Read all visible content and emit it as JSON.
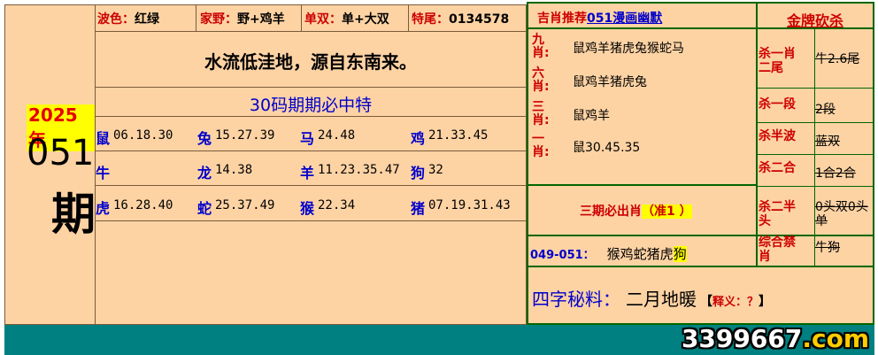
{
  "header": {
    "bose_label": "波色：",
    "bose_value": "红绿",
    "jiaye_label": "家野：",
    "jiaye_value": "野+鸡羊",
    "danshuang_label": "单双：",
    "danshuang_value": "单+大双",
    "tewei_label": "特尾：",
    "tewei_value": "0134578"
  },
  "issue": {
    "year": "2025年",
    "number": "051",
    "suffix": "期"
  },
  "slogan": "水流低洼地，源自东南来。",
  "bingo_title": "30码期期必中特",
  "zodiac_table": [
    [
      {
        "z": "鼠",
        "n": "06.18.30"
      },
      {
        "z": "兔",
        "n": "15.27.39"
      },
      {
        "z": "马",
        "n": "24.48"
      },
      {
        "z": "鸡",
        "n": "21.33.45"
      }
    ],
    [
      {
        "z": "牛",
        "n": ""
      },
      {
        "z": "龙",
        "n": "14.38"
      },
      {
        "z": "羊",
        "n": "11.23.35.47"
      },
      {
        "z": "狗",
        "n": "32"
      }
    ],
    [
      {
        "z": "虎",
        "n": "16.28.40"
      },
      {
        "z": "蛇",
        "n": "25.37.49"
      },
      {
        "z": "猴",
        "n": "22.34"
      },
      {
        "z": "猪",
        "n": "07.19.31.43"
      }
    ]
  ],
  "right": {
    "title_prefix": "吉肖推荐",
    "title_link": "051漫画幽默",
    "brand": "金牌砍杀",
    "rec_rows": [
      {
        "label": "九肖:",
        "value": "鼠鸡羊猪虎兔猴蛇马"
      },
      {
        "label": "六肖:",
        "value": "鼠鸡羊猪虎兔"
      },
      {
        "label": "三肖:",
        "value": "鼠鸡羊"
      },
      {
        "label": "一肖:",
        "value": "鼠30.45.35"
      }
    ],
    "kill_rows": [
      {
        "label": "杀一肖二尾",
        "value": "牛2.6尾"
      },
      {
        "label": "杀一段",
        "value": "2段"
      },
      {
        "label": "杀半波",
        "value": "蓝双"
      },
      {
        "label": "杀二合",
        "value": "1合2合"
      },
      {
        "label": "杀二半头",
        "value": "0头双0头单"
      },
      {
        "label": "综合禁肖",
        "value": "牛狗"
      }
    ],
    "three_term_label": "三期必出肖",
    "three_term_badge": "（准1 ）",
    "range_label": "049-051：",
    "range_zodiacs": "猴鸡蛇猪虎",
    "range_highlight": "狗",
    "secret_label": "四字秘料：",
    "secret_value": "二月地暖",
    "explain_open": "【",
    "explain_text": "释义：？",
    "explain_close": "】"
  },
  "watermark": {
    "prefix": "3399667",
    "suffix": ".com"
  }
}
